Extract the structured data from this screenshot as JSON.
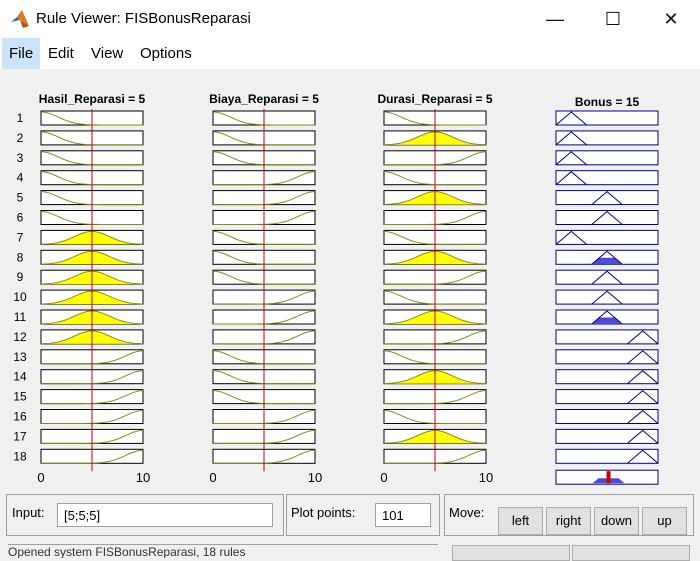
{
  "window": {
    "title": "Rule Viewer: FISBonusReparasi",
    "minimize_glyph": "—",
    "maximize_glyph": "☐",
    "close_glyph": "✕"
  },
  "menu": [
    {
      "label": "File"
    },
    {
      "label": "Edit"
    },
    {
      "label": "View"
    },
    {
      "label": "Options"
    }
  ],
  "rule_numbers": [
    "1",
    "2",
    "3",
    "4",
    "5",
    "6",
    "7",
    "8",
    "9",
    "10",
    "11",
    "12",
    "13",
    "14",
    "15",
    "16",
    "17",
    "18"
  ],
  "variables": [
    {
      "header": "Hasil_Reparasi = 5",
      "axis_min": "0",
      "axis_max": "10",
      "value": 5,
      "mfs": [
        "lo",
        "lo",
        "lo",
        "lo",
        "lo",
        "lo",
        "md",
        "md",
        "md",
        "md",
        "md",
        "md",
        "hi",
        "hi",
        "hi",
        "hi",
        "hi",
        "hi"
      ]
    },
    {
      "header": "Biaya_Reparasi = 5",
      "axis_min": "0",
      "axis_max": "10",
      "value": 5,
      "mfs": [
        "lo",
        "lo",
        "lo",
        "hi",
        "hi",
        "hi",
        "lo",
        "lo",
        "lo",
        "hi",
        "hi",
        "hi",
        "lo",
        "lo",
        "lo",
        "hi",
        "hi",
        "hi"
      ]
    },
    {
      "header": "Durasi_Reparasi = 5",
      "axis_min": "0",
      "axis_max": "10",
      "value": 5,
      "mfs": [
        "lo",
        "md",
        "hi",
        "lo",
        "md",
        "hi",
        "lo",
        "md",
        "hi",
        "lo",
        "md",
        "hi",
        "lo",
        "md",
        "hi",
        "lo",
        "md",
        "hi"
      ]
    }
  ],
  "output": {
    "header": "Bonus = 15",
    "centers": [
      0.15,
      0.15,
      0.15,
      0.15,
      0.5,
      0.5,
      0.15,
      0.5,
      0.5,
      0.5,
      0.5,
      0.85,
      0.85,
      0.85,
      0.85,
      0.85,
      0.85,
      0.85
    ],
    "fills": [
      0,
      0,
      0,
      0,
      0,
      0,
      0,
      0.5,
      0,
      0,
      0.5,
      0,
      0,
      0,
      0,
      0,
      0,
      0
    ],
    "aggregate_value": 15
  },
  "colors": {
    "mf_fill": "#ffff00",
    "mf_line": "#8a8a20",
    "input_line": "#cc0000",
    "output_line": "#00008b",
    "output_fill": "#4b4bd6",
    "hl_bar": "#ffff00"
  },
  "controls": {
    "input_label": "Input:",
    "input_value": "[5;5;5]",
    "plot_points_label": "Plot points:",
    "plot_points_value": "101",
    "move_label": "Move:",
    "buttons": [
      {
        "label": "left"
      },
      {
        "label": "right"
      },
      {
        "label": "down"
      },
      {
        "label": "up"
      }
    ]
  },
  "status_text": "Opened system FISBonusReparasi, 18 rules"
}
